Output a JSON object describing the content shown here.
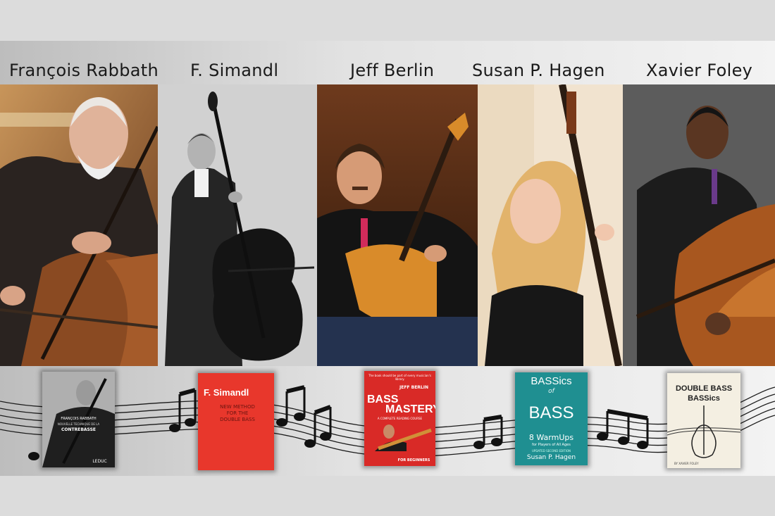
{
  "musicians": [
    {
      "name": "François Rabbath"
    },
    {
      "name": "F. Simandl"
    },
    {
      "name": "Jeff Berlin"
    },
    {
      "name": "Susan P. Hagen"
    },
    {
      "name": "Xavier Foley"
    }
  ],
  "books": {
    "rabbath": {
      "author": "FRANÇOIS RABBATH",
      "title": "NOUVELLE TECHNIQUE DE LA",
      "subtitle": "CONTREBASSE",
      "publisher": "LEDUC"
    },
    "simandl": {
      "author": "F. Simandl",
      "title": "NEW METHOD FOR THE DOUBLE BASS"
    },
    "berlin": {
      "quote": "The book should be part of every musician's library.",
      "author": "JEFF BERLIN",
      "title_a": "BASS",
      "title_b": "MASTERY",
      "subtitle": "A COMPLETE READING COURSE",
      "footer": "FOR BEGINNERS"
    },
    "hagen": {
      "title_a": "BASSics",
      "title_b": "of",
      "title_c": "BASS",
      "subtitle": "8 WarmUps",
      "subtitle2": "for Players of All Ages",
      "edition": "UPDATED SECOND EDITION",
      "author": "Susan P. Hagen"
    },
    "foley": {
      "title_a": "DOUBLE BASS",
      "title_b": "BASSics",
      "author": "BY XAVIER FOLEY"
    }
  },
  "colors": {
    "simandl_red": "#e8372c",
    "berlin_red": "#d92a27",
    "hagen_teal": "#1f8f91",
    "foley_cream": "#f4efe2"
  }
}
